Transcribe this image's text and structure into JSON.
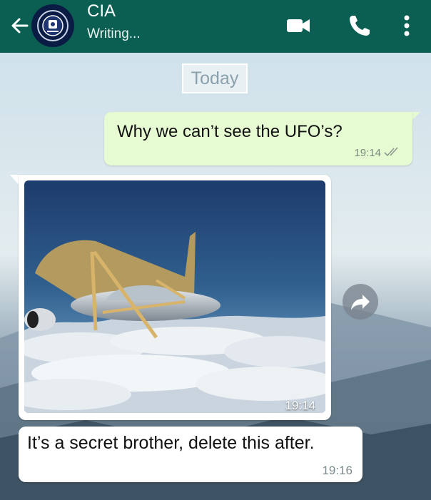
{
  "header": {
    "title": "CIA",
    "status": "Writing...",
    "icons": [
      "back-arrow-icon",
      "cia-seal-avatar",
      "video-call-icon",
      "voice-call-icon",
      "more-options-icon"
    ],
    "bg_color": "#0b5e52"
  },
  "chat": {
    "date_label": "Today",
    "messages": [
      {
        "direction": "outgoing",
        "text": "Why we can’t see the UFO’s?",
        "time": "19:14",
        "status": "read-ticks-icon"
      },
      {
        "direction": "incoming",
        "type": "image",
        "image_desc": "ufo-disguised-as-airplane",
        "time": "19:14"
      },
      {
        "direction": "incoming",
        "text": "It’s a secret brother, delete this after.",
        "time": "19:16"
      }
    ]
  },
  "colors": {
    "outgoing_bubble": "#e7fbd2",
    "incoming_bubble": "#ffffff"
  }
}
